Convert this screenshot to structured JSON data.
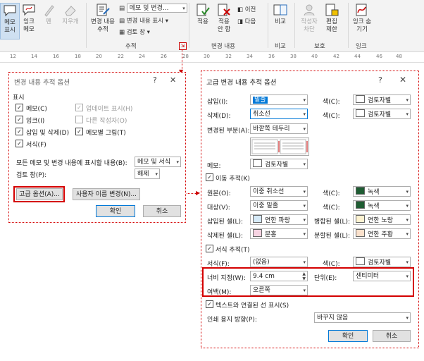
{
  "ribbon": {
    "buttons": [
      {
        "label": "메모\n표시",
        "state": "active"
      },
      {
        "label": "잉크\n메모",
        "state": "normal"
      },
      {
        "label": "펜",
        "state": "disabled"
      },
      {
        "label": "지우개",
        "state": "disabled"
      }
    ],
    "track_changes_label": "변경 내용\n추적",
    "markup_select": "메모 및 변경...",
    "show_markup_label": "변경 내용 표시",
    "review_pane_label": "검토 창",
    "tracking_group": "추적",
    "accept_label": "적용",
    "reject_label": "적용\n안 함",
    "previous_label": "이전",
    "next_label": "다음",
    "changes_group": "변경 내용",
    "compare_label": "비교",
    "compare_group": "비교",
    "block_authors_label": "작성자\n차단",
    "restrict_editing_label": "편집\n제한",
    "protect_group": "보호",
    "hide_ink_label": "잉크 숨\n기기",
    "ink_group": "잉크"
  },
  "ruler": {
    "ticks": [
      "12",
      "14",
      "16",
      "18",
      "20",
      "22",
      "24",
      "26",
      "28",
      "30",
      "32",
      "34",
      "36",
      "38",
      "40",
      "42",
      "44",
      "46",
      "48"
    ]
  },
  "track_changes_options": {
    "title": "변경 내용 추적 옵션",
    "help": "?",
    "close": "✕",
    "section_show": "표시",
    "checkboxes": [
      {
        "label": "메모(C)",
        "checked": true,
        "enabled": true
      },
      {
        "label": "잉크(I)",
        "checked": true,
        "enabled": true
      },
      {
        "label": "삽입 및 삭제(D)",
        "checked": true,
        "enabled": true
      },
      {
        "label": "서식(F)",
        "checked": true,
        "enabled": true
      },
      {
        "label": "업데이트 표시(H)",
        "checked": true,
        "enabled": false
      },
      {
        "label": "다른 작성자(O)",
        "checked": false,
        "enabled": false
      },
      {
        "label": "메모별 그림(T)",
        "checked": true,
        "enabled": true
      }
    ],
    "balloons_label": "모든 메모 및 변경 내용에 표시할 내용(B):",
    "balloons_value": "메모 및 서식",
    "review_pane_label": "검토 창(P):",
    "review_pane_value": "해제",
    "advanced_button": "고급 옵션(A)...",
    "change_user_button": "사용자 이름 변경(N)...",
    "ok": "확인",
    "cancel": "취소"
  },
  "advanced_options": {
    "title": "고급 변경 내용 추적 옵션",
    "help": "?",
    "close": "✕",
    "insertions_label": "삽입(I):",
    "insertions_value": "밑줄",
    "deletions_label": "삭제(D):",
    "deletions_value": "취소선",
    "changed_lines_label": "변경된 부분(A):",
    "changed_lines_value": "바깥쪽 테두리",
    "color_label": "색(C):",
    "by_author": "검토자별",
    "comments_label": "메모:",
    "comments_value": "검토자별",
    "track_moves": "이동 추적(K)",
    "moved_from_label": "원본(O):",
    "moved_from_value": "이중 취소선",
    "moved_to_label": "대상(V):",
    "moved_to_value": "이중 밑줄",
    "green_value": "녹색",
    "green_hex": "#1e5c32",
    "inserted_cells_label": "삽입된 셀(L):",
    "inserted_cells_value": "연한 파랑",
    "inserted_cells_hex": "#d6eaf8",
    "merged_cells_label": "병합된 셀(L):",
    "merged_cells_value": "연한 노랑",
    "merged_cells_hex": "#fdf2d0",
    "deleted_cells_label": "삭제된 셀(L):",
    "deleted_cells_value": "분홍",
    "deleted_cells_hex": "#f7d3e2",
    "split_cells_label": "분할된 셀(L):",
    "split_cells_value": "연한 주황",
    "split_cells_hex": "#fbe1cc",
    "track_formatting": "서식 추적(T)",
    "formatting_label": "서식(F):",
    "formatting_value": "(없음)",
    "width_label": "너비 지정(W):",
    "width_value": "9.4 cm",
    "unit_label": "단위(E):",
    "unit_value": "센티미터",
    "margin_label": "여백(M):",
    "margin_value": "오른쪽",
    "show_lines": "텍스트와 연결된 선 표시(S)",
    "print_orientation_label": "인쇄 용지 방향(P):",
    "print_orientation_value": "바꾸지 않음",
    "ok": "확인",
    "cancel": "취소"
  }
}
